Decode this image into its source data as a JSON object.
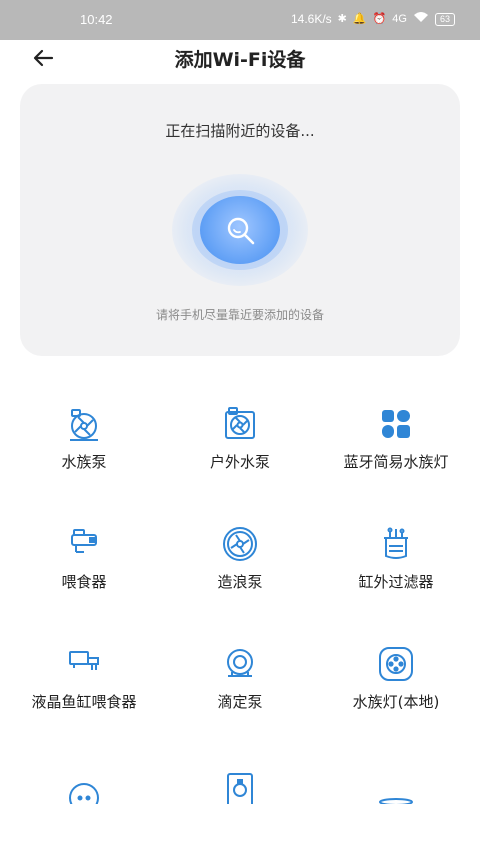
{
  "status_bar": {
    "time": "10:42",
    "net_speed": "14.6K/s",
    "signal": "4G",
    "battery": "63"
  },
  "header": {
    "title": "添加Wi-Fi设备"
  },
  "scan": {
    "status_text": "正在扫描附近的设备...",
    "hint": "请将手机尽量靠近要添加的设备"
  },
  "devices": [
    {
      "label": "水族泵",
      "icon": "aquarium-pump-icon"
    },
    {
      "label": "户外水泵",
      "icon": "outdoor-pump-icon"
    },
    {
      "label": "蓝牙简易水族灯",
      "icon": "bluetooth-light-icon"
    },
    {
      "label": "喂食器",
      "icon": "feeder-icon"
    },
    {
      "label": "造浪泵",
      "icon": "wave-pump-icon"
    },
    {
      "label": "缸外过滤器",
      "icon": "external-filter-icon"
    },
    {
      "label": "液晶鱼缸喂食器",
      "icon": "lcd-feeder-icon"
    },
    {
      "label": "滴定泵",
      "icon": "dosing-pump-icon"
    },
    {
      "label": "水族灯(本地)",
      "icon": "aquarium-light-local-icon"
    }
  ],
  "colors": {
    "accent": "#2f86d6",
    "card_bg": "#f2f2f3",
    "status_bar": "#b8b8b8"
  }
}
